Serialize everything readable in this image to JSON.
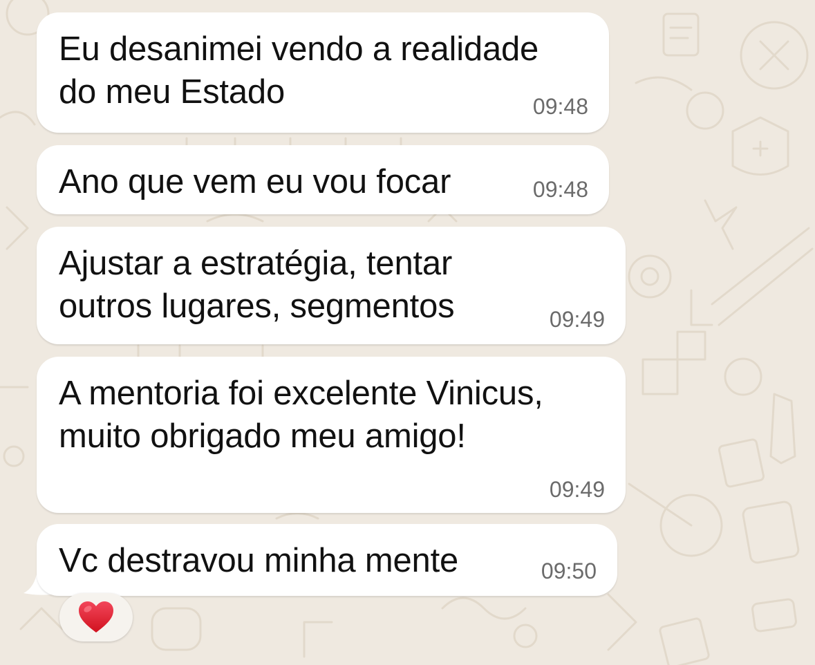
{
  "chat": {
    "messages": [
      {
        "text": "Eu desanimei vendo a realidade\ndo meu Estado",
        "time": "09:48"
      },
      {
        "text": "Ano que vem eu vou focar",
        "time": "09:48"
      },
      {
        "text": "Ajustar a estratégia, tentar\noutros lugares, segmentos",
        "time": "09:49"
      },
      {
        "text": "A mentoria foi excelente Vinicus,\nmuito obrigado meu amigo!",
        "time": "09:49"
      },
      {
        "text": "Vc destravou minha mente",
        "time": "09:50"
      }
    ],
    "reaction": {
      "emoji_name": "red-heart",
      "color": "#e0242f"
    }
  },
  "colors": {
    "background": "#efe9e0",
    "bubble": "#ffffff",
    "text": "#111111",
    "timestamp": "#6b6b6b"
  }
}
